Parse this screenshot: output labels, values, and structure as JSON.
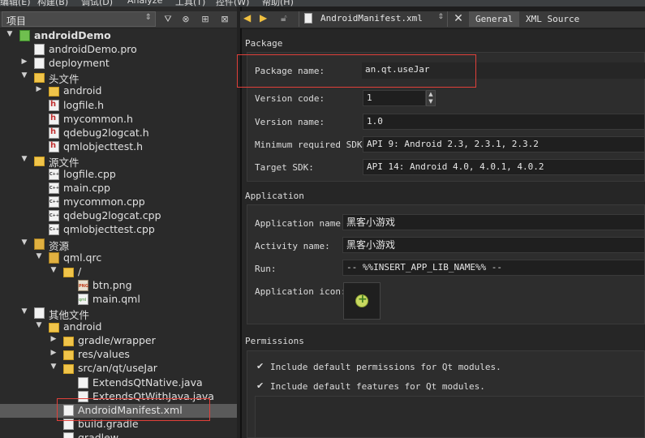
{
  "menu": [
    "编辑(E)",
    "构建(B)",
    "调试(D)",
    "Analyze",
    "工具(T)",
    "控件(W)",
    "帮助(H)"
  ],
  "project_pane": {
    "combo_label": "项目",
    "tree": [
      {
        "label": "androidDemo",
        "depth": 0,
        "expanded": true,
        "icon": "qt-project-icon",
        "bold": true
      },
      {
        "label": "androidDemo.pro",
        "depth": 1,
        "icon": "pro-file-icon"
      },
      {
        "label": "deployment",
        "depth": 1,
        "expanded": false,
        "icon": "file-icon"
      },
      {
        "label": "头文件",
        "depth": 1,
        "expanded": true,
        "icon": "header-folder-icon"
      },
      {
        "label": "android",
        "depth": 2,
        "expanded": false,
        "icon": "folder-icon"
      },
      {
        "label": "logfile.h",
        "depth": 2,
        "icon": "header-file-icon"
      },
      {
        "label": "mycommon.h",
        "depth": 2,
        "icon": "header-file-icon"
      },
      {
        "label": "qdebug2logcat.h",
        "depth": 2,
        "icon": "header-file-icon"
      },
      {
        "label": "qmlobjecttest.h",
        "depth": 2,
        "icon": "header-file-icon"
      },
      {
        "label": "源文件",
        "depth": 1,
        "expanded": true,
        "icon": "source-folder-icon"
      },
      {
        "label": "logfile.cpp",
        "depth": 2,
        "icon": "cpp-file-icon"
      },
      {
        "label": "main.cpp",
        "depth": 2,
        "icon": "cpp-file-icon"
      },
      {
        "label": "mycommon.cpp",
        "depth": 2,
        "icon": "cpp-file-icon"
      },
      {
        "label": "qdebug2logcat.cpp",
        "depth": 2,
        "icon": "cpp-file-icon"
      },
      {
        "label": "qmlobjecttest.cpp",
        "depth": 2,
        "icon": "cpp-file-icon"
      },
      {
        "label": "资源",
        "depth": 1,
        "expanded": true,
        "icon": "resource-lock-icon"
      },
      {
        "label": "qml.qrc",
        "depth": 2,
        "expanded": true,
        "icon": "resource-lock-icon"
      },
      {
        "label": "/",
        "depth": 3,
        "expanded": true,
        "icon": "folder-icon"
      },
      {
        "label": "btn.png",
        "depth": 4,
        "icon": "png-file-icon"
      },
      {
        "label": "main.qml",
        "depth": 4,
        "icon": "qml-file-icon"
      },
      {
        "label": "其他文件",
        "depth": 1,
        "expanded": true,
        "icon": "other-files-icon"
      },
      {
        "label": "android",
        "depth": 2,
        "expanded": true,
        "icon": "folder-icon"
      },
      {
        "label": "gradle/wrapper",
        "depth": 3,
        "expanded": false,
        "icon": "folder-icon"
      },
      {
        "label": "res/values",
        "depth": 3,
        "expanded": false,
        "icon": "folder-icon"
      },
      {
        "label": "src/an/qt/useJar",
        "depth": 3,
        "expanded": true,
        "icon": "folder-icon"
      },
      {
        "label": "ExtendsQtNative.java",
        "depth": 4,
        "icon": "java-file-icon"
      },
      {
        "label": "ExtendsQtWithJava.java",
        "depth": 4,
        "icon": "java-file-icon"
      },
      {
        "label": "AndroidManifest.xml",
        "depth": 3,
        "icon": "xml-file-icon",
        "selected": true
      },
      {
        "label": "build.gradle",
        "depth": 3,
        "icon": "file-icon"
      },
      {
        "label": "gradlew",
        "depth": 3,
        "icon": "file-icon"
      }
    ]
  },
  "editor": {
    "file_name": "AndroidManifest.xml",
    "tabs": [
      "General",
      "XML Source"
    ],
    "active_tab": "General",
    "package": {
      "title": "Package",
      "package_name_label": "Package name:",
      "package_name": "an.qt.useJar",
      "version_code_label": "Version code:",
      "version_code": "1",
      "version_name_label": "Version name:",
      "version_name": "1.0",
      "min_sdk_label": "Minimum required SDK:",
      "min_sdk": "API 9: Android 2.3, 2.3.1, 2.3.2",
      "target_sdk_label": "Target SDK:",
      "target_sdk": "API 14: Android 4.0, 4.0.1, 4.0.2"
    },
    "application": {
      "title": "Application",
      "app_name_label": "Application name:",
      "app_name": "黑客小游戏",
      "activity_name_label": "Activity name:",
      "activity_name": "黑客小游戏",
      "run_label": "Run:",
      "run_value": "-- %%INSERT_APP_LIB_NAME%% --",
      "icon_label": "Application icon:"
    },
    "permissions": {
      "title": "Permissions",
      "include_permissions": "Include default permissions for Qt modules.",
      "include_features": "Include default features for Qt modules."
    }
  },
  "colors": {
    "highlight_box": "#e0403a",
    "selection": "#5a5a5a"
  }
}
